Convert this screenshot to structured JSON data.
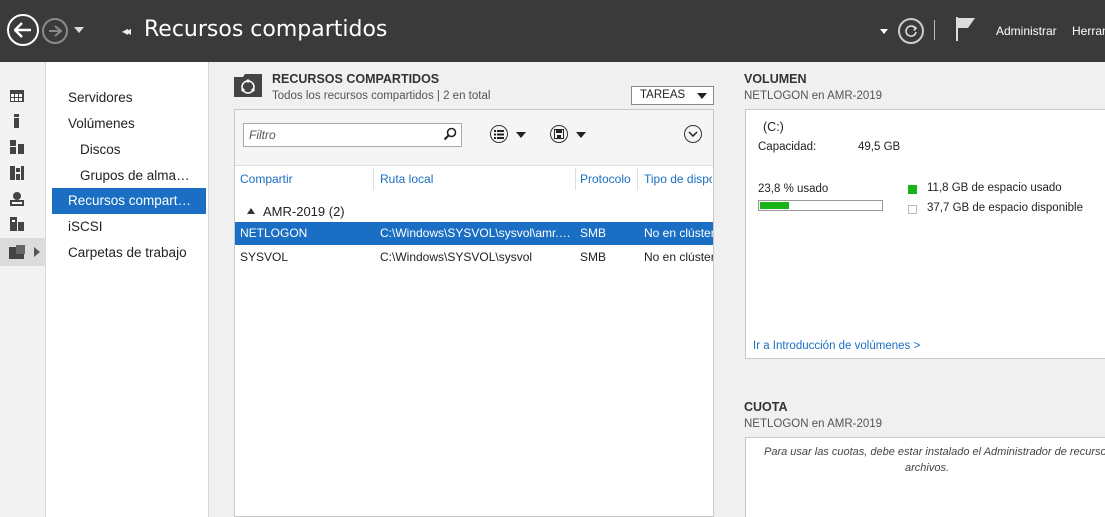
{
  "titlebar": {
    "title": "Recursos compartidos",
    "breadcrumb_chevron": "◂◂",
    "menu": [
      "Administrar",
      "Herramientas"
    ]
  },
  "nav": {
    "items": [
      {
        "label": "Servidores"
      },
      {
        "label": "Volúmenes"
      },
      {
        "label": "Discos"
      },
      {
        "label": "Grupos de almacenamiento"
      },
      {
        "label": "Recursos compartidos"
      },
      {
        "label": "iSCSI"
      },
      {
        "label": "Carpetas de trabajo"
      }
    ],
    "selected": "Recursos compartidos"
  },
  "shares": {
    "title": "RECURSOS COMPARTIDOS",
    "subtitle": "Todos los recursos compartidos | 2 en total",
    "tasks_label": "TAREAS",
    "filter_placeholder": "Filtro",
    "columns": [
      "Compartir",
      "Ruta local",
      "Protocolo",
      "Tipo de disponibilidad"
    ],
    "group_label": "AMR-2019 (2)",
    "rows": [
      {
        "share": "NETLOGON",
        "path": "C:\\Windows\\SYSVOL\\sysvol\\amr.local\\SCRIPTS",
        "protocol": "SMB",
        "availability": "No en clúster"
      },
      {
        "share": "SYSVOL",
        "path": "C:\\Windows\\SYSVOL\\sysvol",
        "protocol": "SMB",
        "availability": "No en clúster"
      }
    ]
  },
  "volume": {
    "title": "VOLUMEN",
    "subtitle": "NETLOGON en AMR-2019",
    "drive": "(C:)",
    "capacity_label": "Capacidad:",
    "capacity_value": "49,5 GB",
    "used_pct_label": "23,8 % usado",
    "used_fraction": 0.238,
    "used_color": "#17b317",
    "free_color": "#ffffff",
    "used_legend": "11,8 GB de espacio usado",
    "free_legend": "37,7 GB de espacio disponible",
    "link": "Ir a Introducción de volúmenes >"
  },
  "quota": {
    "title": "CUOTA",
    "subtitle": "NETLOGON en AMR-2019",
    "message_line1": "Para usar las cuotas, debe estar instalado el Administrador de recursos del servidor de",
    "message_line2": "archivos."
  },
  "colors": {
    "accent": "#1a6fc4",
    "titlebar_bg": "#3a3a3a"
  }
}
